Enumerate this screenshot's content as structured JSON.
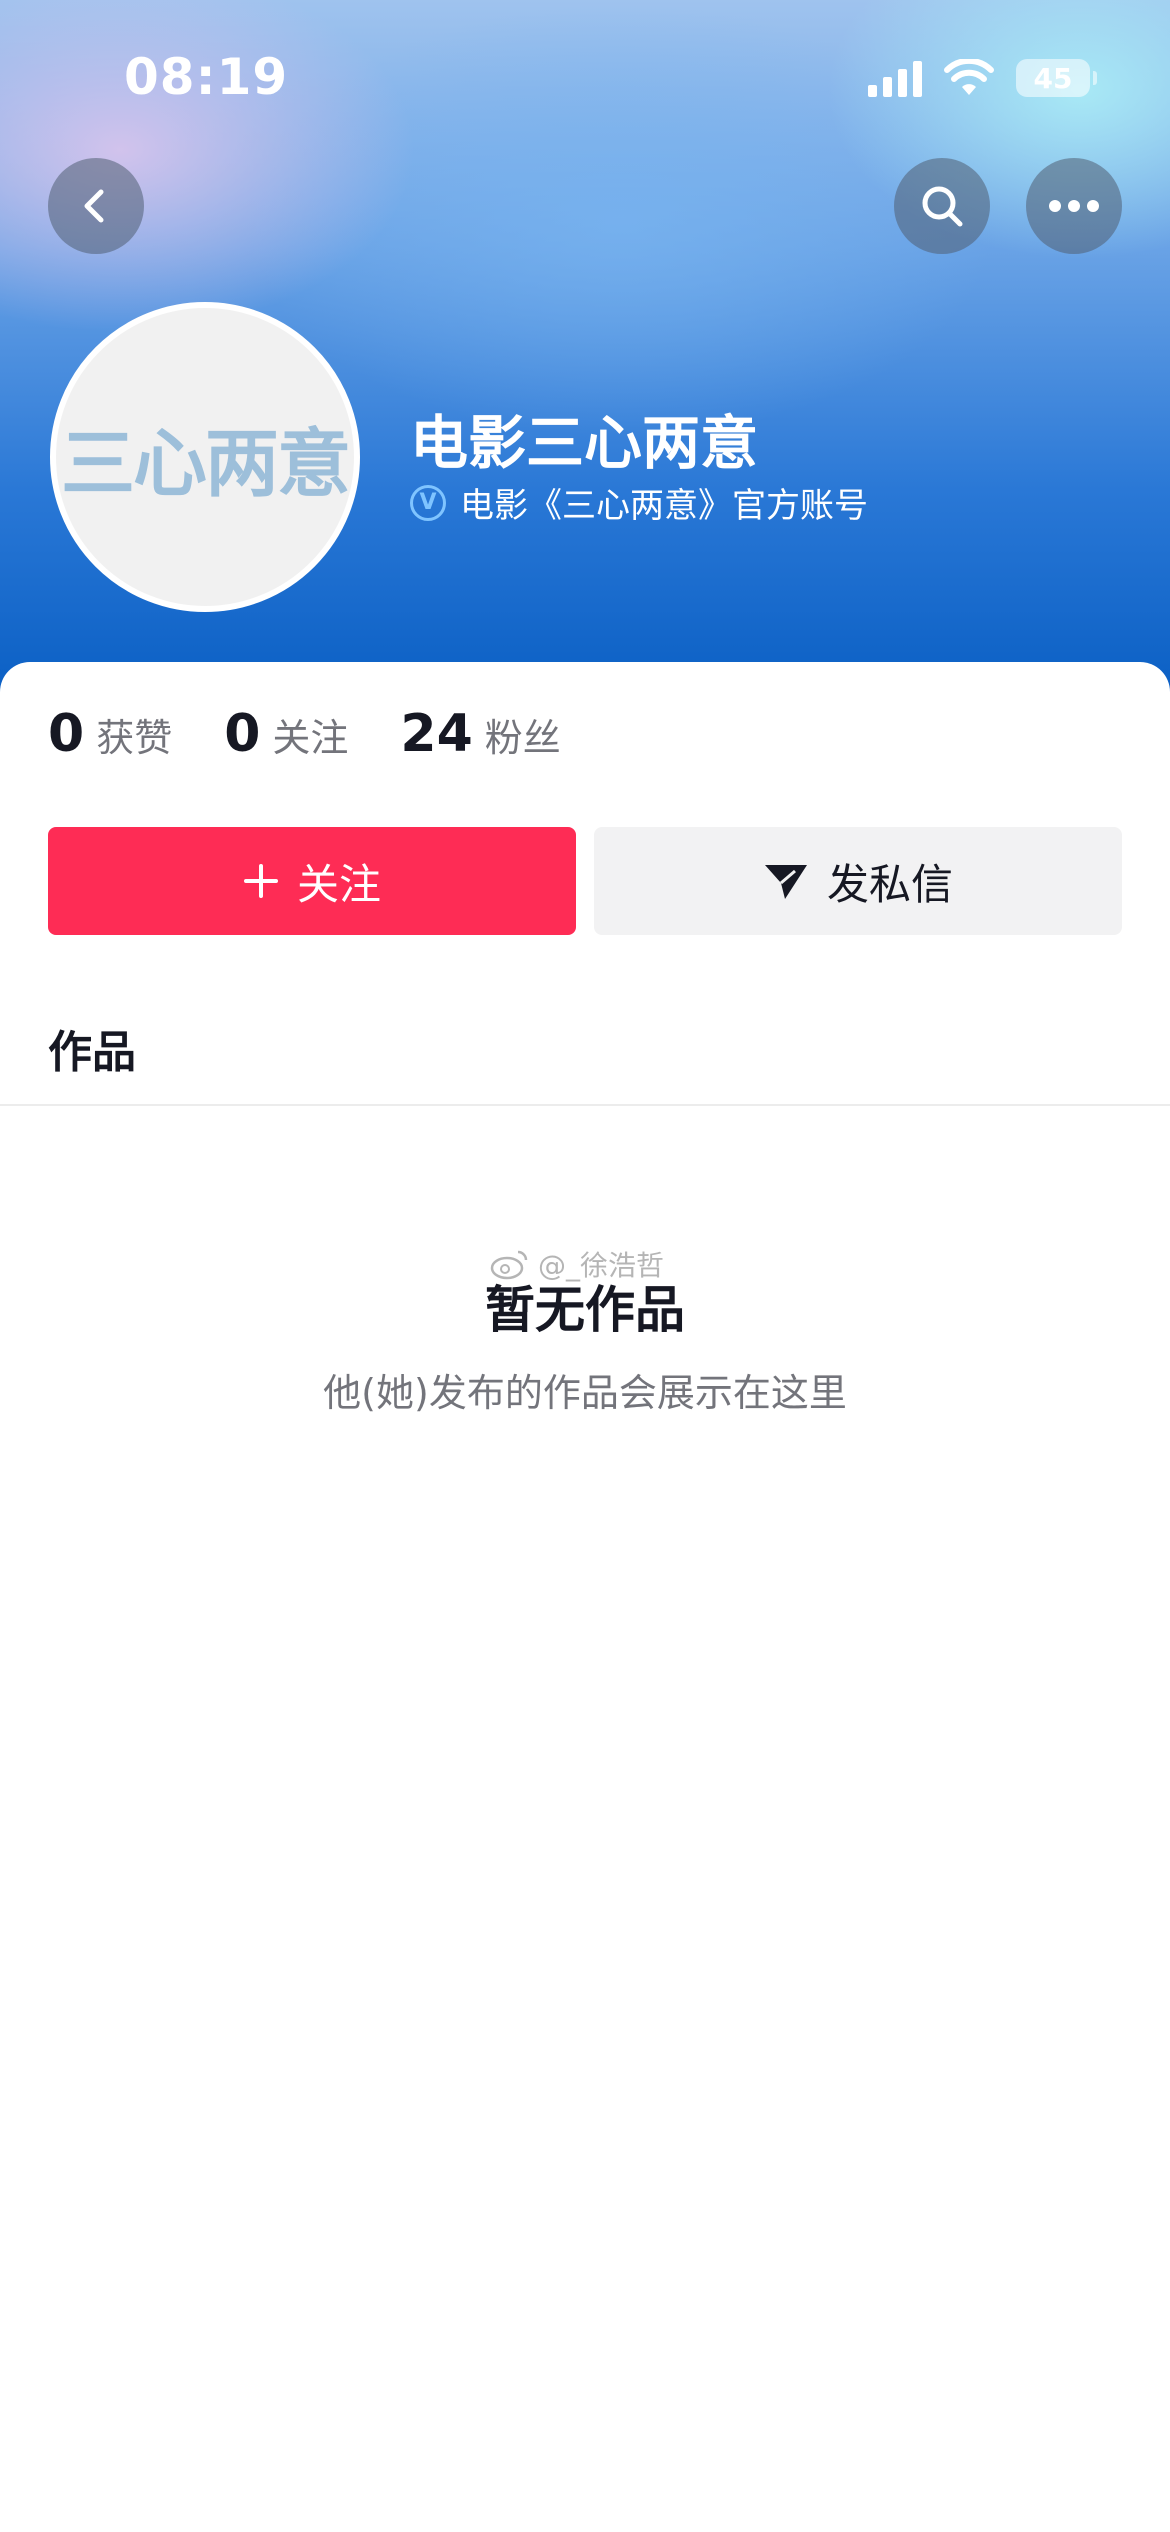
{
  "status_bar": {
    "time": "08:19",
    "battery": "45"
  },
  "profile": {
    "avatar_text": "三心两意",
    "name": "电影三心两意",
    "verified_text": "电影《三心两意》官方账号",
    "verified_badge": "V"
  },
  "stats": [
    {
      "value": "0",
      "label": "获赞"
    },
    {
      "value": "0",
      "label": "关注"
    },
    {
      "value": "24",
      "label": "粉丝"
    }
  ],
  "actions": {
    "follow_label": "关注",
    "message_label": "发私信"
  },
  "tabs": {
    "works_label": "作品"
  },
  "empty_state": {
    "title": "暂无作品",
    "subtitle": "他(她)发布的作品会展示在这里"
  },
  "watermark": "@_徐浩哲",
  "icons": {
    "back": "chevron-left-icon",
    "search": "search-icon",
    "more": "more-horizontal-icon",
    "follow": "plus-icon",
    "message": "send-icon",
    "watermark": "weibo-icon"
  },
  "colors": {
    "accent": "#fe2c55",
    "verified": "#7fc4ff"
  }
}
